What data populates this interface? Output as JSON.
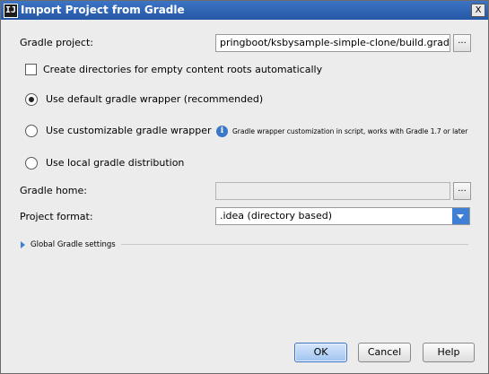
{
  "window": {
    "title": "Import Project from Gradle",
    "close_label": "X",
    "icon_label": "IJ"
  },
  "gradle_project": {
    "label": "Gradle project:",
    "value": "pringboot/ksbysample-simple-clone/build.gradle",
    "browse_label": "..."
  },
  "create_dirs": {
    "label": "Create directories for empty content roots automatically",
    "checked": false
  },
  "wrapper_options": [
    {
      "label": "Use default gradle wrapper (recommended)",
      "selected": true
    },
    {
      "label": "Use customizable gradle wrapper",
      "selected": false
    },
    {
      "label": "Use local gradle distribution",
      "selected": false
    }
  ],
  "wrapper_hint": {
    "icon_glyph": "i",
    "text": "Gradle wrapper customization in script, works with Gradle 1.7 or later"
  },
  "gradle_home": {
    "label": "Gradle home:",
    "value": "",
    "browse_label": "..."
  },
  "project_format": {
    "label": "Project format:",
    "value": ".idea (directory based)"
  },
  "global_settings": {
    "label": "Global Gradle settings",
    "expanded": false
  },
  "buttons": {
    "ok": "OK",
    "cancel": "Cancel",
    "help": "Help"
  },
  "colors": {
    "accent": "#3f7fd6",
    "title_bar": "#2557a6",
    "dialog_bg": "#ececec"
  }
}
